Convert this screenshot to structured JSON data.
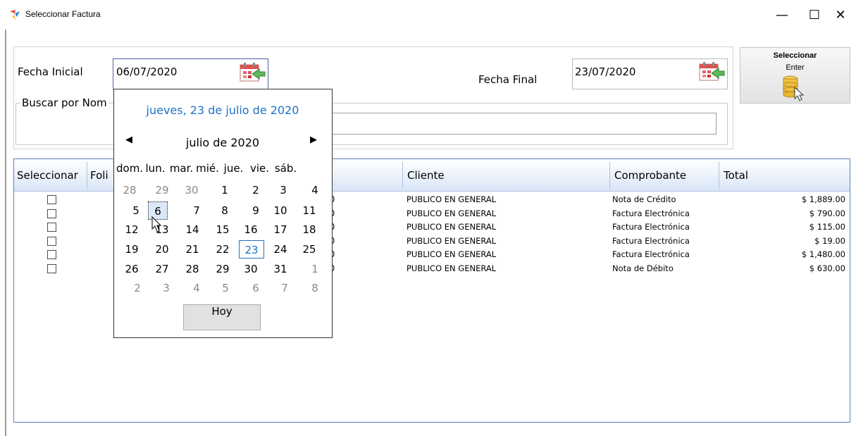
{
  "window": {
    "title": "Seleccionar Factura",
    "minimize": "—",
    "maximize": "☐",
    "close": "✕"
  },
  "filters": {
    "fecha_inicial_label": "Fecha Inicial",
    "fecha_inicial_value": "06/07/2020",
    "fecha_final_label": "Fecha Final",
    "fecha_final_value": "23/07/2020",
    "buscar_label": "Buscar por Nom",
    "search_value": ""
  },
  "select_button": {
    "title": "Seleccionar",
    "subtitle": "Enter"
  },
  "grid": {
    "headers": {
      "seleccionar": "Seleccionar",
      "folio": "Foli",
      "cliente": "Cliente",
      "comprobante": "Comprobante",
      "total": "Total"
    },
    "rows": [
      {
        "fecha": "20",
        "cliente": "PUBLICO EN GENERAL",
        "comprobante": "Nota de Crédito",
        "total": "$ 1,889.00"
      },
      {
        "fecha": "20",
        "cliente": "PUBLICO EN GENERAL",
        "comprobante": "Factura Electrónica",
        "total": "$ 790.00"
      },
      {
        "fecha": "20",
        "cliente": "PUBLICO EN GENERAL",
        "comprobante": "Factura Electrónica",
        "total": "$ 115.00"
      },
      {
        "fecha": "20",
        "cliente": "PUBLICO EN GENERAL",
        "comprobante": "Factura Electrónica",
        "total": "$ 19.00"
      },
      {
        "fecha": "20",
        "cliente": "PUBLICO EN GENERAL",
        "comprobante": "Factura Electrónica",
        "total": "$ 1,480.00"
      },
      {
        "fecha": "20",
        "cliente": "PUBLICO EN GENERAL",
        "comprobante": "Nota de Débito",
        "total": "$ 630.00"
      }
    ]
  },
  "calendar": {
    "today_text": "jueves, 23 de julio de 2020",
    "month_label": "julio de 2020",
    "prev": "◀",
    "next": "▶",
    "dow": [
      "dom.",
      "lun.",
      "mar.",
      "mié.",
      "jue.",
      "vie.",
      "sáb."
    ],
    "weeks": [
      [
        "28",
        "29",
        "30",
        "1",
        "2",
        "3",
        "4"
      ],
      [
        "5",
        "6",
        "7",
        "8",
        "9",
        "10",
        "11"
      ],
      [
        "12",
        "13",
        "14",
        "15",
        "16",
        "17",
        "18"
      ],
      [
        "19",
        "20",
        "21",
        "22",
        "23",
        "24",
        "25"
      ],
      [
        "26",
        "27",
        "28",
        "29",
        "30",
        "31",
        "1"
      ],
      [
        "2",
        "3",
        "4",
        "5",
        "6",
        "7",
        "8"
      ]
    ],
    "selected_day": "6",
    "today_day": "23",
    "hoy_label": "Hoy"
  },
  "colors": {
    "accent": "#1e73c5",
    "grid_border": "#5c7ebd",
    "header_bg": "#d9e6f7"
  }
}
